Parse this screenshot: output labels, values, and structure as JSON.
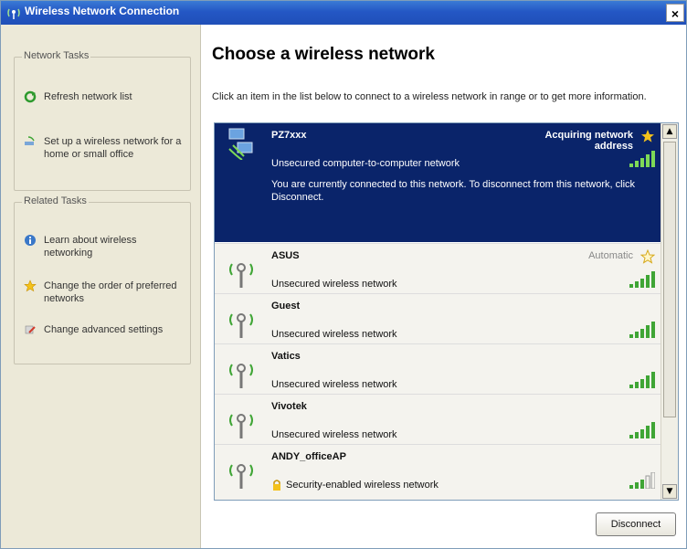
{
  "window": {
    "title": "Wireless Network Connection",
    "close_label": "×"
  },
  "left_pane": {
    "network_tasks": {
      "title": "Network Tasks",
      "items": [
        {
          "label": "Refresh network list",
          "icon": "refresh-icon"
        },
        {
          "label": "Set up a wireless network for a home or small office",
          "icon": "setup-network-icon"
        }
      ]
    },
    "related_tasks": {
      "title": "Related Tasks",
      "items": [
        {
          "label": "Learn about wireless networking",
          "icon": "info-icon"
        },
        {
          "label": "Change the order of preferred networks",
          "icon": "star-icon"
        },
        {
          "label": "Change advanced settings",
          "icon": "settings-icon"
        }
      ]
    }
  },
  "main": {
    "heading": "Choose a wireless network",
    "instruction": "Click an item in the list below to connect to a wireless network in range or to get more information.",
    "networks": [
      {
        "ssid": "PZ7xxx",
        "description": "Unsecured computer-to-computer network",
        "status": "Acquiring network address",
        "detail": "You are currently connected to this network. To disconnect from this network, click Disconnect.",
        "selected": true,
        "signal": 5
      },
      {
        "ssid": "ASUS",
        "description": "Unsecured wireless network",
        "status": "Automatic",
        "signal": 5
      },
      {
        "ssid": "Guest",
        "description": "Unsecured wireless network",
        "status": "",
        "signal": 5
      },
      {
        "ssid": "Vatics",
        "description": "Unsecured wireless network",
        "status": "",
        "signal": 5
      },
      {
        "ssid": "Vivotek",
        "description": "Unsecured wireless network",
        "status": "",
        "signal": 5
      },
      {
        "ssid": "ANDY_officeAP",
        "description": "Security-enabled wireless network",
        "status": "",
        "signal": 3
      }
    ],
    "disconnect_label": "Disconnect"
  },
  "colors": {
    "titlebar": "#2457c5",
    "selected_row": "#0a246a",
    "signal_green": "#3fa535"
  }
}
